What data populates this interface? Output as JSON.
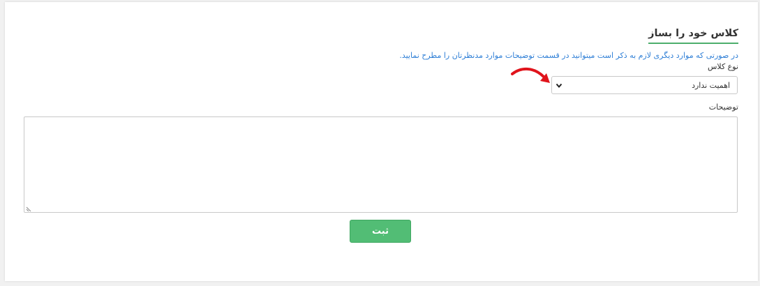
{
  "form": {
    "title": "کلاس خود را بساز",
    "hint": "در صورتی که موارد دیگری لازم به ذکر است میتوانید در قسمت توضیحات موارد مدنظرتان را مطرح نمایید.",
    "class_type_label": "نوع کلاس",
    "class_type_value": "اهمیت ندارد",
    "description_label": "توضیحات",
    "description_value": "",
    "submit_label": "ثبت"
  },
  "colors": {
    "accent_green": "#52bd75",
    "hint_blue": "#2f7fd6",
    "annotation_arrow_red": "#e0141c"
  },
  "icons": {
    "select_chevron": "chevron-down-icon",
    "annotation": "red-curved-arrow-icon",
    "resize": "resize-handle-icon"
  }
}
